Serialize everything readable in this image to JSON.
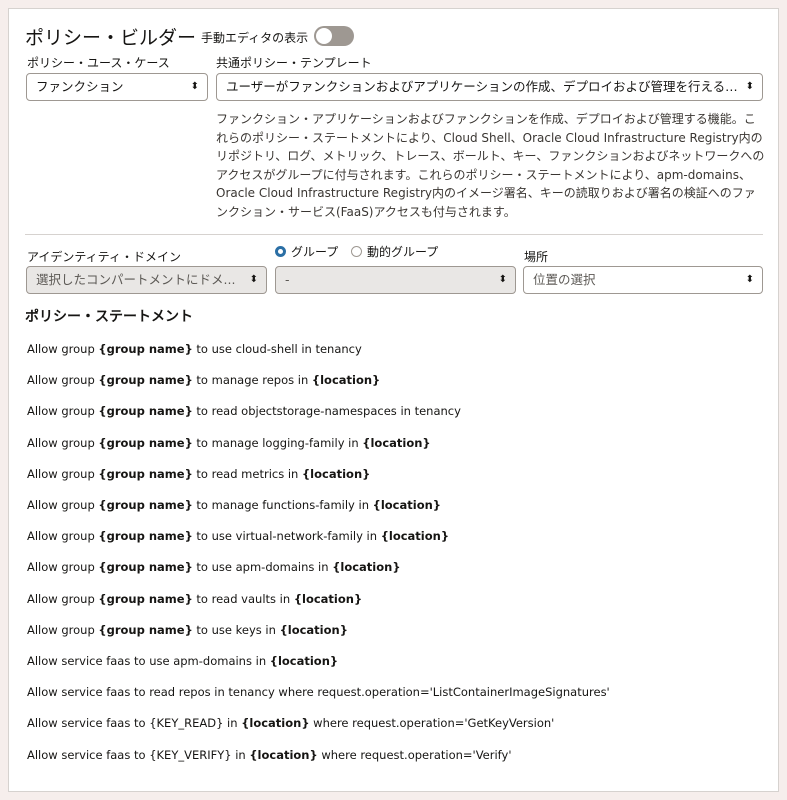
{
  "header": {
    "title": "ポリシー・ビルダー",
    "manual_editor_label": "手動エディタの表示"
  },
  "use_case": {
    "label": "ポリシー・ユース・ケース",
    "value": "ファンクション"
  },
  "template": {
    "label": "共通ポリシー・テンプレート",
    "value": "ユーザーがファンクションおよびアプリケーションの作成、デプロイおよび管理を行えるように...",
    "description": "ファンクション・アプリケーションおよびファンクションを作成、デプロイおよび管理する機能。これらのポリシー・ステートメントにより、Cloud Shell、Oracle Cloud Infrastructure Registry内のリポジトリ、ログ、メトリック、トレース、ボールト、キー、ファンクションおよびネットワークへのアクセスがグループに付与されます。これらのポリシー・ステートメントにより、apm-domains、Oracle Cloud Infrastructure Registry内のイメージ署名、キーの読取りおよび署名の検証へのファンクション・サービス(FaaS)アクセスも付与されます。"
  },
  "identity_domain": {
    "label": "アイデンティティ・ドメイン",
    "value": "選択したコンパートメントにドメ..."
  },
  "group_type": {
    "options": [
      "グループ",
      "動的グループ"
    ],
    "selected": "グループ"
  },
  "group_select": {
    "value": "-"
  },
  "location": {
    "label": "場所",
    "value": "位置の選択"
  },
  "statements": {
    "title": "ポリシー・ステートメント",
    "items": [
      [
        {
          "t": "Allow group ",
          "b": false
        },
        {
          "t": "{group name}",
          "b": true
        },
        {
          "t": " to use cloud-shell in tenancy",
          "b": false
        }
      ],
      [
        {
          "t": "Allow group ",
          "b": false
        },
        {
          "t": "{group name}",
          "b": true
        },
        {
          "t": " to manage repos in ",
          "b": false
        },
        {
          "t": "{location}",
          "b": true
        }
      ],
      [
        {
          "t": "Allow group ",
          "b": false
        },
        {
          "t": "{group name}",
          "b": true
        },
        {
          "t": " to read objectstorage-namespaces in tenancy",
          "b": false
        }
      ],
      [
        {
          "t": "Allow group ",
          "b": false
        },
        {
          "t": "{group name}",
          "b": true
        },
        {
          "t": " to manage logging-family in ",
          "b": false
        },
        {
          "t": "{location}",
          "b": true
        }
      ],
      [
        {
          "t": "Allow group ",
          "b": false
        },
        {
          "t": "{group name}",
          "b": true
        },
        {
          "t": " to read metrics in ",
          "b": false
        },
        {
          "t": "{location}",
          "b": true
        }
      ],
      [
        {
          "t": "Allow group ",
          "b": false
        },
        {
          "t": "{group name}",
          "b": true
        },
        {
          "t": " to manage functions-family in ",
          "b": false
        },
        {
          "t": "{location}",
          "b": true
        }
      ],
      [
        {
          "t": "Allow group ",
          "b": false
        },
        {
          "t": "{group name}",
          "b": true
        },
        {
          "t": " to use virtual-network-family in ",
          "b": false
        },
        {
          "t": "{location}",
          "b": true
        }
      ],
      [
        {
          "t": "Allow group ",
          "b": false
        },
        {
          "t": "{group name}",
          "b": true
        },
        {
          "t": " to use apm-domains in ",
          "b": false
        },
        {
          "t": "{location}",
          "b": true
        }
      ],
      [
        {
          "t": "Allow group ",
          "b": false
        },
        {
          "t": "{group name}",
          "b": true
        },
        {
          "t": " to read vaults in ",
          "b": false
        },
        {
          "t": "{location}",
          "b": true
        }
      ],
      [
        {
          "t": "Allow group ",
          "b": false
        },
        {
          "t": "{group name}",
          "b": true
        },
        {
          "t": " to use keys in ",
          "b": false
        },
        {
          "t": "{location}",
          "b": true
        }
      ],
      [
        {
          "t": "Allow service faas to use apm-domains in ",
          "b": false
        },
        {
          "t": "{location}",
          "b": true
        }
      ],
      [
        {
          "t": "Allow service faas to read repos in tenancy where request.operation='ListContainerImageSignatures'",
          "b": false
        }
      ],
      [
        {
          "t": "Allow service faas to {KEY_READ} in ",
          "b": false
        },
        {
          "t": "{location}",
          "b": true
        },
        {
          "t": " where request.operation='GetKeyVersion'",
          "b": false
        }
      ],
      [
        {
          "t": "Allow service faas to {KEY_VERIFY} in ",
          "b": false
        },
        {
          "t": "{location}",
          "b": true
        },
        {
          "t": " where request.operation='Verify'",
          "b": false
        }
      ]
    ]
  }
}
